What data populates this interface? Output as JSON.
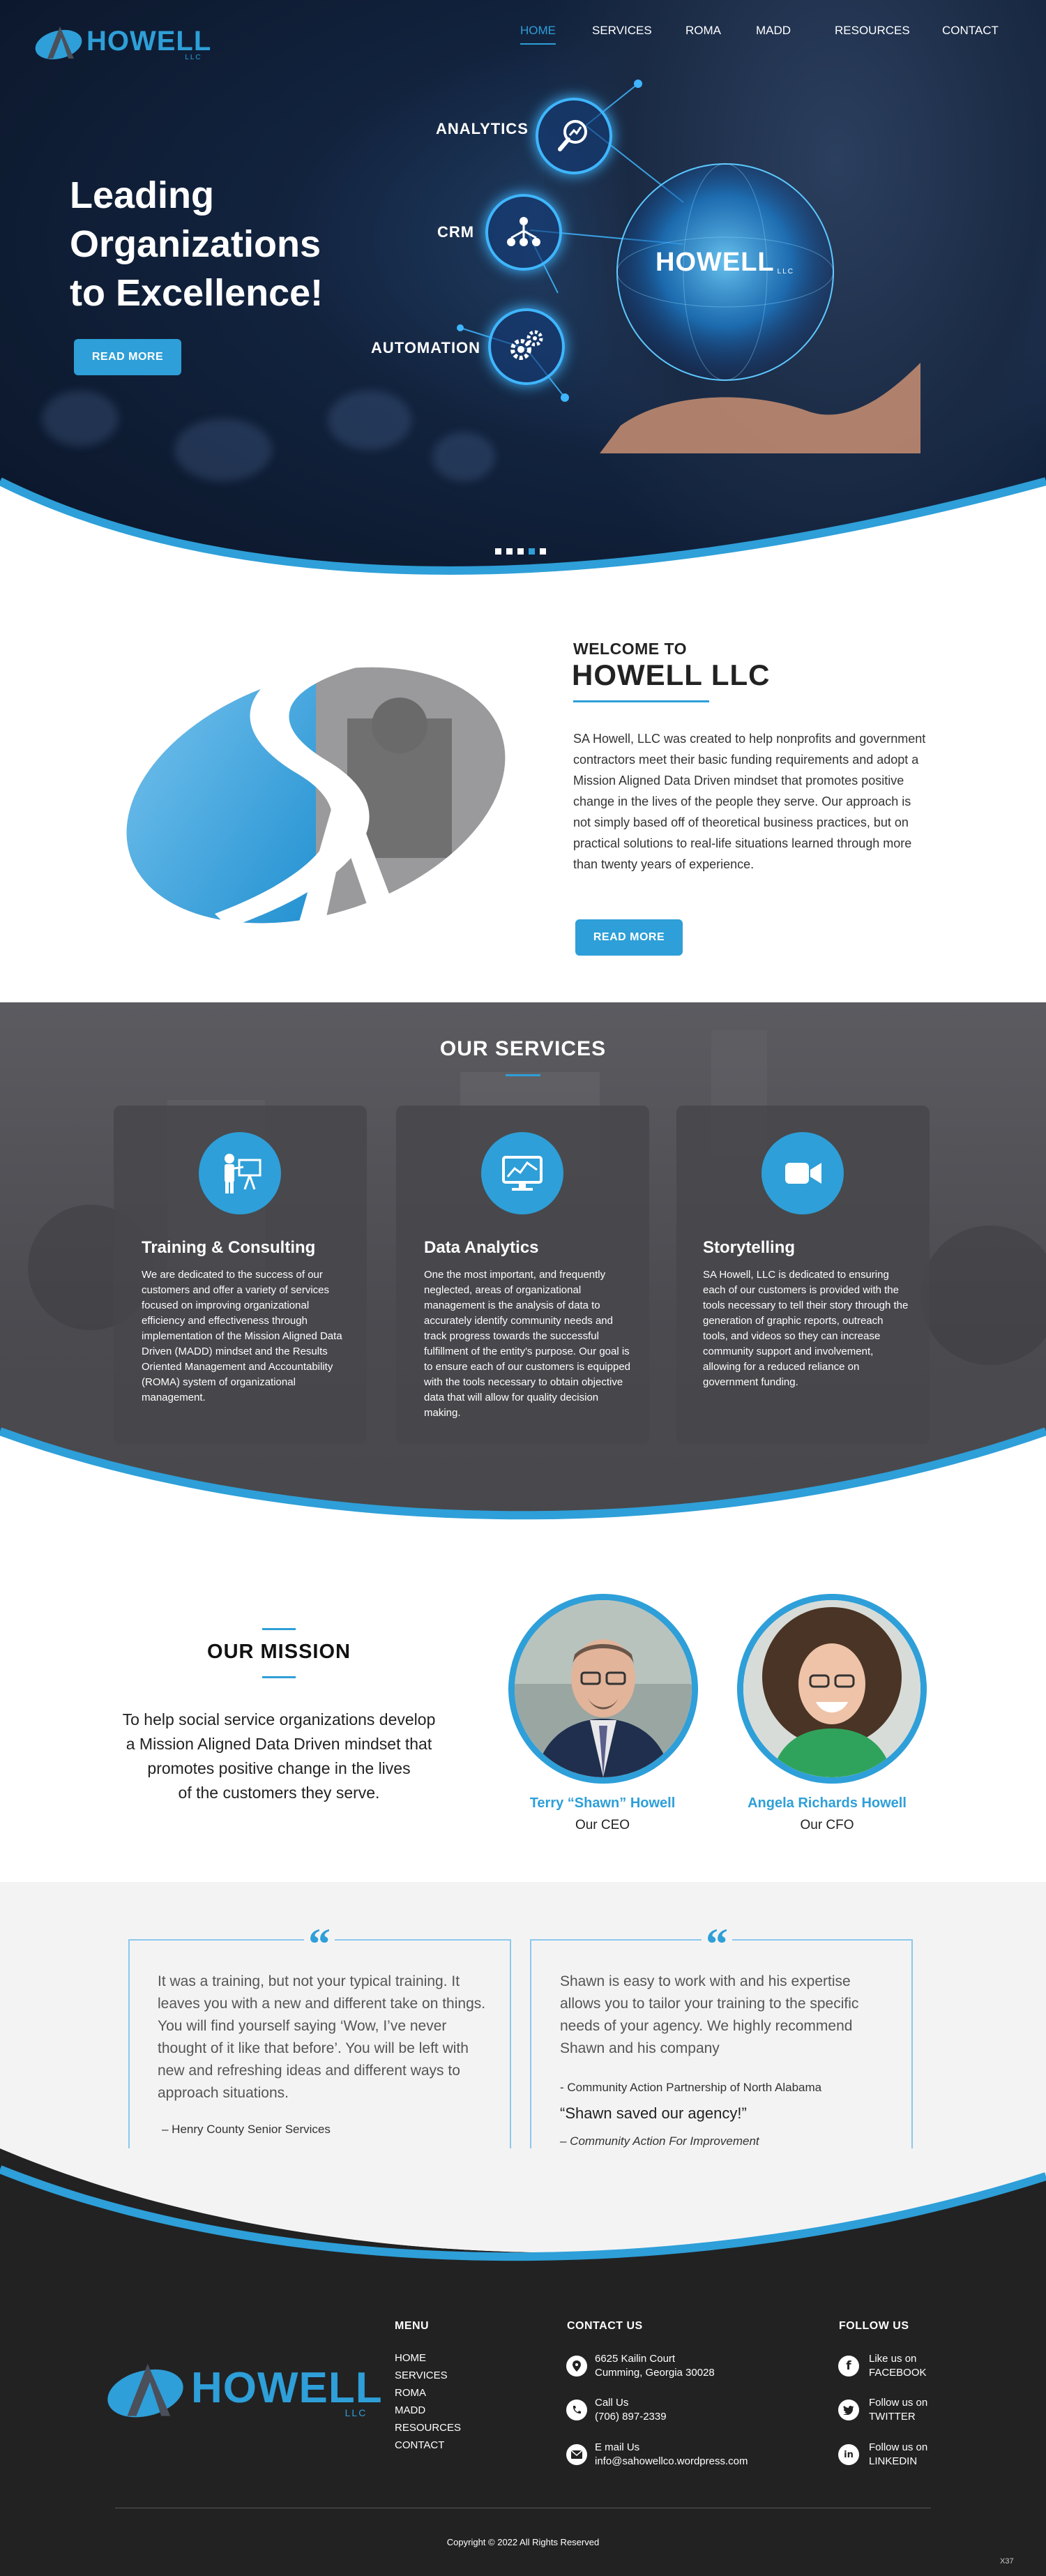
{
  "colors": {
    "accent": "#2e9fd8",
    "hero_bg": "#0a1426",
    "services_bg": "#4a4a4f",
    "footer_bg": "#222223",
    "testimonial_bg": "#f4f3f4"
  },
  "brand": {
    "name": "HOWELL",
    "suffix": "LLC"
  },
  "nav": {
    "items": [
      "HOME",
      "SERVICES",
      "ROMA",
      "MADD",
      "RESOURCES",
      "CONTACT"
    ],
    "active": "HOME"
  },
  "hero": {
    "title_line1": "Leading",
    "title_line2": "Organizations",
    "title_line3": "to Excellence!",
    "button": "READ MORE",
    "labels": [
      "ANALYTICS",
      "CRM",
      "AUTOMATION"
    ],
    "globe_logo_name": "HOWELL",
    "globe_logo_suffix": "LLC",
    "icons": [
      "analytics-icon",
      "crm-network-icon",
      "gears-icon"
    ],
    "slide_count": 5,
    "active_slide": 4
  },
  "welcome": {
    "subtitle": "WELCOME TO",
    "title": "HOWELL LLC",
    "body": "SA Howell, LLC was created to help nonprofits and government contractors meet their basic funding requirements and adopt a Mission Aligned Data Driven mindset that promotes positive change in the lives of the people they serve. Our approach is not simply based off of theoretical business practices, but on practical solutions to real-life situations learned through more than twenty years of experience.",
    "button": "READ MORE"
  },
  "services": {
    "title": "OUR SERVICES",
    "cards": [
      {
        "icon": "presenter-icon",
        "title": "Training & Consulting",
        "body": "We are dedicated to the success of our customers and offer a variety of services focused on improving organizational efficiency and effectiveness through implementation of the Mission Aligned Data Driven (MADD) mindset and the Results Oriented Management and Accountability (ROMA) system of organizational management."
      },
      {
        "icon": "chart-monitor-icon",
        "title": "Data Analytics",
        "body": "One the most important, and frequently neglected, areas of organizational management is the analysis of data to accurately identify community needs and track progress towards the successful fulfillment of the entity's purpose. Our goal is to ensure each of our customers is equipped with the tools necessary to obtain objective data that will allow for quality decision making."
      },
      {
        "icon": "video-camera-icon",
        "title": "Storytelling",
        "body": "SA Howell, LLC is dedicated to ensuring each of our customers is provided with the tools necessary to tell their story through the generation of graphic reports, outreach tools, and videos so they can increase community support and involvement, allowing for a reduced reliance on government funding."
      }
    ]
  },
  "mission": {
    "title": "OUR MISSION",
    "line1": "To help social service organizations develop",
    "line2": "a Mission Aligned Data Driven mindset that",
    "line3": "promotes positive change in the lives",
    "line4": "of the customers they serve.",
    "people": [
      {
        "name": "Terry “Shawn” Howell",
        "role": "Our CEO"
      },
      {
        "name": "Angela Richards Howell",
        "role": "Our CFO"
      }
    ]
  },
  "testimonials": [
    {
      "text": "It was a training, but not your typical training. It leaves you with a new and different take on things. You will find yourself saying ‘Wow, I’ve never thought of it like that before’. You will be left with new and refreshing ideas and different ways to approach situations.",
      "author": "– Henry County Senior Services"
    },
    {
      "text": "Shawn is easy to work with and his expertise allows you to tailor your training to the specific needs of your agency. We highly recommend Shawn and his company",
      "author": "- Community Action Partnership of North Alabama",
      "quote2": "“Shawn saved our agency!”",
      "author2": "– Community Action For Improvement"
    }
  ],
  "footer": {
    "menu_title": "MENU",
    "menu_items": [
      "HOME",
      "SERVICES",
      "ROMA",
      "MADD",
      "RESOURCES",
      "CONTACT"
    ],
    "contact_title": "CONTACT US",
    "address_line1": "6625 Kailin Court",
    "address_line2": "Cumming, Georgia 30028",
    "call_label": "Call Us",
    "phone": "(706) 897-2339",
    "email_label": "E mail Us",
    "email": "info@sahowellco.wordpress.com",
    "follow_title": "FOLLOW US",
    "social": [
      {
        "icon": "facebook-icon",
        "line1": "Like us on",
        "line2": "FACEBOOK"
      },
      {
        "icon": "twitter-icon",
        "line1": "Follow us on",
        "line2": "TWITTER"
      },
      {
        "icon": "linkedin-icon",
        "line1": "Follow us on",
        "line2": "LINKEDIN"
      }
    ],
    "copyright": "Copyright © 2022 All Rights Reserved",
    "corner": "X37"
  }
}
